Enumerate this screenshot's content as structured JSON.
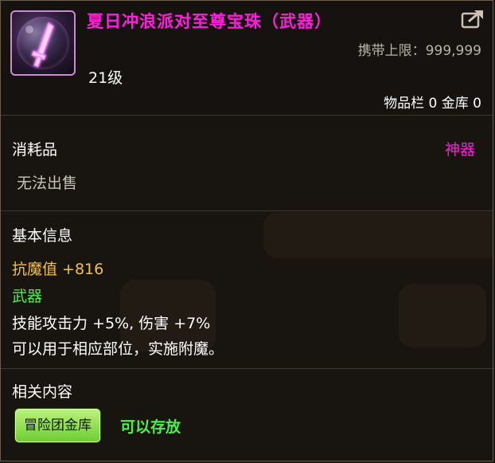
{
  "item": {
    "name": "夏日冲浪派对至尊宝珠（武器）",
    "carry_limit": "携带上限：999,999",
    "level": "21级",
    "inventory": "物品栏 0 金库 0",
    "icon": "purple-sword-orb-icon",
    "rarity_color": "#ff1edc"
  },
  "consumable": {
    "type": "消耗品",
    "grade": "神器",
    "sell_status": "无法出售"
  },
  "basic_info": {
    "title": "基本信息",
    "stat": "抗魔值 +816",
    "equip_slot": "武器",
    "effect": "技能攻击力 +5%, 伤害 +7%",
    "usage": "可以用于相应部位，实施附魔。"
  },
  "related": {
    "title": "相关内容",
    "storage_button": "冒险团金库",
    "storage_status": "可以存放"
  },
  "colors": {
    "gold": "#f2c14a",
    "green": "#4bf24b",
    "magenta": "#ff1edc"
  }
}
